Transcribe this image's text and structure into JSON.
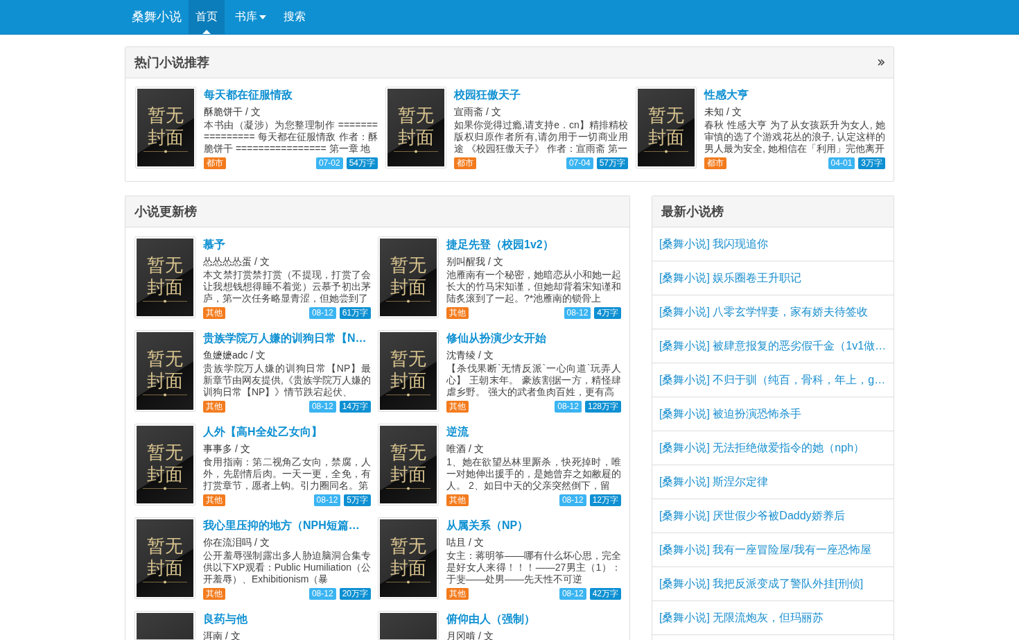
{
  "navbar": {
    "brand": "桑舞小说",
    "items": [
      {
        "label": "首页",
        "selected": true,
        "kind": "link"
      },
      {
        "label": "书库",
        "selected": false,
        "kind": "dropdown"
      },
      {
        "label": "搜索",
        "selected": false,
        "kind": "link"
      }
    ]
  },
  "hot_panel": {
    "title": "热门小说推荐",
    "books": [
      {
        "cover_text": "暂无封面",
        "title": "每天都在征服情敌",
        "author": "酥脆饼干 / 文",
        "description": "本书由（凝涉）为您整理制作 ================ 每天都在征服情敌 作者：酥脆饼干 ================ 第一章 地",
        "category": "都市",
        "updated": "07-02",
        "words": "54万字"
      },
      {
        "cover_text": "暂无封面",
        "title": "校园狂傲天子",
        "author": "宣雨斋 / 文",
        "description": "如果你觉得过瘾,请支持e．cn】精排精校版权归原作者所有,请勿用于一切商业用途 《校园狂傲天子》 作者：宣雨斋 第一",
        "category": "都市",
        "updated": "07-04",
        "words": "57万字"
      },
      {
        "cover_text": "暂无封面",
        "title": "性感大亨",
        "author": "未知 / 文",
        "description": "春秋 性感大亨 为了从女孩跃升为女人, 她审慎的选了个游戏花丛的浪子, 认定这样的男人最为安全, 她相信在「利用」完他离开",
        "category": "都市",
        "updated": "04-01",
        "words": "3万字"
      }
    ]
  },
  "update_panel": {
    "title": "小说更新榜",
    "books": [
      {
        "cover_text": "暂无封面",
        "title": "慕予",
        "author": "怂怂怂怂蛋 / 文",
        "description": "本文禁打赏禁打赏（不提现，打赏了会让我想钱想得睡不着觉）云慕予初出茅庐，第一次任务略显青涩，但她尝到了",
        "category": "其他",
        "updated": "08-12",
        "words": "61万字"
      },
      {
        "cover_text": "暂无封面",
        "title": "捷足先登（校园1v2）",
        "author": "别叫醒我 / 文",
        "description": "池雁南有一个秘密，她暗恋从小和她一起长大的竹马宋知谨，但她却背着宋知谨和陆炙滚到了一起。?*池雁南的锁骨上",
        "category": "其他",
        "updated": "08-12",
        "words": "4万字"
      },
      {
        "cover_text": "暂无封面",
        "title": "贵族学院万人嫌的训狗日常【N…",
        "author": "鱼嬷嬷adc / 文",
        "description": "贵族学院万人嫌的训狗日常【NP】最新章节由网友提供,《贵族学院万人嫌的训狗日常【NP】》情节跌宕起伏、",
        "category": "其他",
        "updated": "08-12",
        "words": "14万字"
      },
      {
        "cover_text": "暂无封面",
        "title": "修仙从扮演少女开始",
        "author": "沈青绫 / 文",
        "description": "【杀伐果断`无情反派`一心向道`玩弄人心】 王朝末年。 豪族割据一方，精怪肆虐乡野。 强大的武者鱼肉百姓，更有高",
        "category": "其他",
        "updated": "08-12",
        "words": "128万字"
      },
      {
        "cover_text": "暂无封面",
        "title": "人外【高H全处乙女向】",
        "author": "事事多 / 文",
        "description": "食用指南：第二视角乙女向，禁腐，人外，先剧情后肉。一天一更，全免，有打赏章节，愿者上钩。引力圈同名。第",
        "category": "其他",
        "updated": "08-12",
        "words": "5万字"
      },
      {
        "cover_text": "暂无封面",
        "title": "逆流",
        "author": "唯酒 / 文",
        "description": "1、她在欲望丛林里厮杀，快死掉时，唯一对她伸出援手的，是她曾弃之如敝屣的人。 2、如日中天的父亲突然倒下，留",
        "category": "其他",
        "updated": "08-12",
        "words": "12万字"
      },
      {
        "cover_text": "暂无封面",
        "title": "我心里压抑的地方（NPH短篇…",
        "author": "你在流泪吗 / 文",
        "description": "公开羞辱强制露出多人胁迫脑洞合集专供以下XP观看：Public Humiliation（公开羞辱）、Exhibitionism（暴",
        "category": "其他",
        "updated": "08-12",
        "words": "20万字"
      },
      {
        "cover_text": "暂无封面",
        "title": "从属关系（NP）",
        "author": "咕且 / 文",
        "description": "女主：蒋明筝——哪有什么坏心思，完全是好女人来得！！！——27男主（1）：于斐——处男——先天性不可逆",
        "category": "其他",
        "updated": "08-12",
        "words": "42万字"
      },
      {
        "title": "良药与他",
        "author": "洱南 / 文"
      },
      {
        "title": "俯仰由人（强制）",
        "author": "月冈啃 / 文"
      }
    ]
  },
  "latest_panel": {
    "title": "最新小说榜",
    "items": [
      "[桑舞小说] 我闪现追你",
      "[桑舞小说] 娱乐圈卷王升职记",
      "[桑舞小说] 八零玄学悍妻，家有娇夫待签收",
      "[桑舞小说] 被肆意报复的恶劣假千金（1v1做…",
      "[桑舞小说] 不归于驯（纯百，骨科，年上，g…",
      "[桑舞小说] 被迫扮演恐怖杀手",
      "[桑舞小说] 无法拒绝做爱指令的她（nph）",
      "[桑舞小说] 斯涅尔定律",
      "[桑舞小说] 厌世假少爷被Daddy娇养后",
      "[桑舞小说] 我有一座冒险屋/我有一座恐怖屋",
      "[桑舞小说] 我把反派变成了警队外挂[刑侦]",
      "[桑舞小说] 无限流炮灰，但玛丽苏"
    ]
  }
}
